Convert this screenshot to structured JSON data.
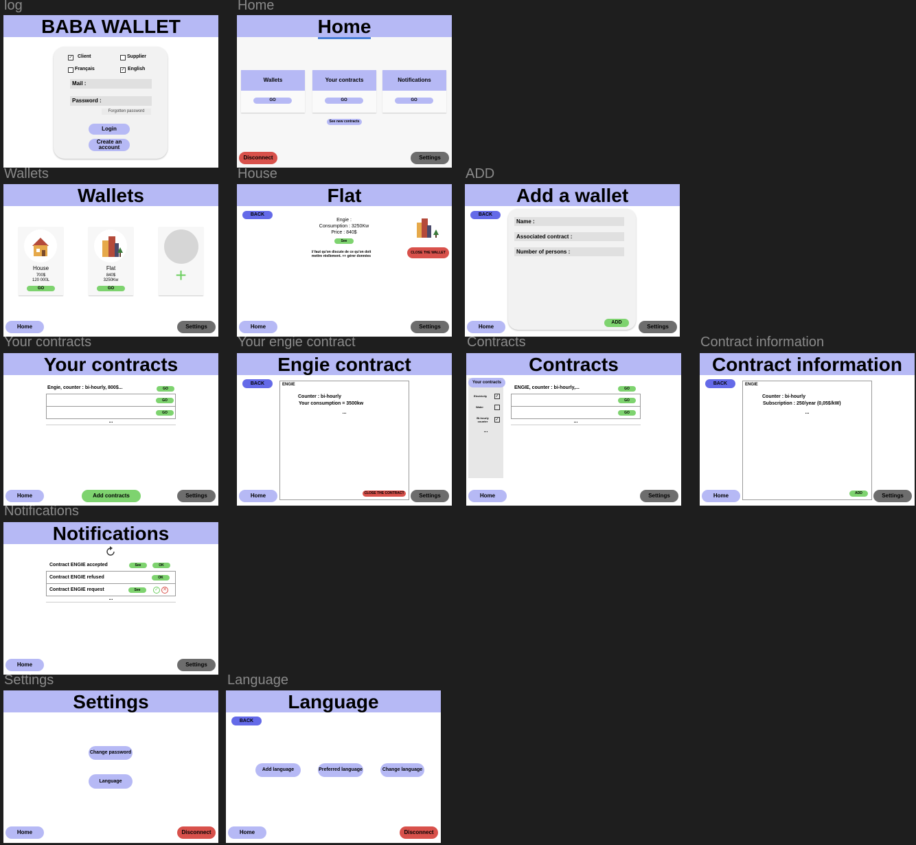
{
  "labels": {
    "log": "log",
    "home": "Home",
    "wallets": "Wallets",
    "house": "House",
    "add": "ADD",
    "your_contracts": "Your contracts",
    "your_engie": "Your engie contract",
    "contracts": "Contracts",
    "contract_info": "Contract information",
    "notifications": "Notifications",
    "settings": "Settings",
    "language": "Language"
  },
  "common": {
    "home": "Home",
    "settings": "Settings",
    "back": "BACK",
    "go": "GO",
    "disconnect": "Disconnect",
    "ellipsis": "...",
    "see": "See",
    "ok": "OK",
    "add": "ADD"
  },
  "login": {
    "title": "BABA WALLET",
    "client": "Client",
    "supplier": "Supplier",
    "francais": "Français",
    "english": "English",
    "mail": "Mail :",
    "password": "Password :",
    "forgotten": "Forgotten password",
    "login_btn": "Login",
    "create_btn": "Create an account"
  },
  "home": {
    "title": "Home",
    "cards": [
      "Wallets",
      "Your contracts",
      "Notifications"
    ],
    "see_new": "See new contracts"
  },
  "wallets": {
    "title": "Wallets",
    "items": [
      {
        "name": "House",
        "price": "700$",
        "detail": "120 000L"
      },
      {
        "name": "Flat",
        "price": "840$",
        "detail": "3250Kw"
      }
    ],
    "add_symbol": "+"
  },
  "flat": {
    "title": "Flat",
    "supplier": "Engie :",
    "consumption": "Consumption : 3250Kw",
    "price": "Price : 840$",
    "note": "// faut qu'on discute de ce qu'on doit mettre réellement. ++ gérer données",
    "close": "CLOSE THE WALLET"
  },
  "add_wallet": {
    "title": "Add a wallet",
    "name": "Name :",
    "contract": "Associated contract :",
    "persons": "Number of persons :"
  },
  "your_contracts": {
    "title": "Your contracts",
    "row1": "Engie, counter : bi-hourly, 800$...",
    "add_btn": "Add contracts"
  },
  "engie": {
    "title": "Engie contract",
    "name": "ENGIE",
    "counter": "Counter : bi-hourly",
    "consumption": "Your consumption = 3500kw",
    "close": "CLOSE THE CONTRACT"
  },
  "contracts": {
    "title": "Contracts",
    "sidebar_title": "Your contracts",
    "filters": [
      "Electricity",
      "Water",
      "Bi-hourly counter"
    ],
    "row1": "ENGIE, counter : bi-hourly,..."
  },
  "contract_info": {
    "title": "Contract information",
    "name": "ENGIE",
    "counter": "Counter : bi-hourly",
    "subscription": "Subscription : 250/year (0,05$/kW)"
  },
  "notifications": {
    "title": "Notifications",
    "items": [
      "Contract ENGIE accepted",
      "Contract ENGIE refused",
      "Contract ENGIE request"
    ]
  },
  "settings": {
    "title": "Settings",
    "change_password": "Change password",
    "language": "Language"
  },
  "language": {
    "title": "Language",
    "add": "Add language",
    "preferred": "Preferred language",
    "change": "Change language"
  },
  "colors": {
    "header": "#b6b9f5",
    "back": "#646ae8",
    "settings": "#6d6d6d",
    "disconnect": "#d8514b",
    "go": "#7ed36f",
    "canvas": "#1e1e1e"
  }
}
